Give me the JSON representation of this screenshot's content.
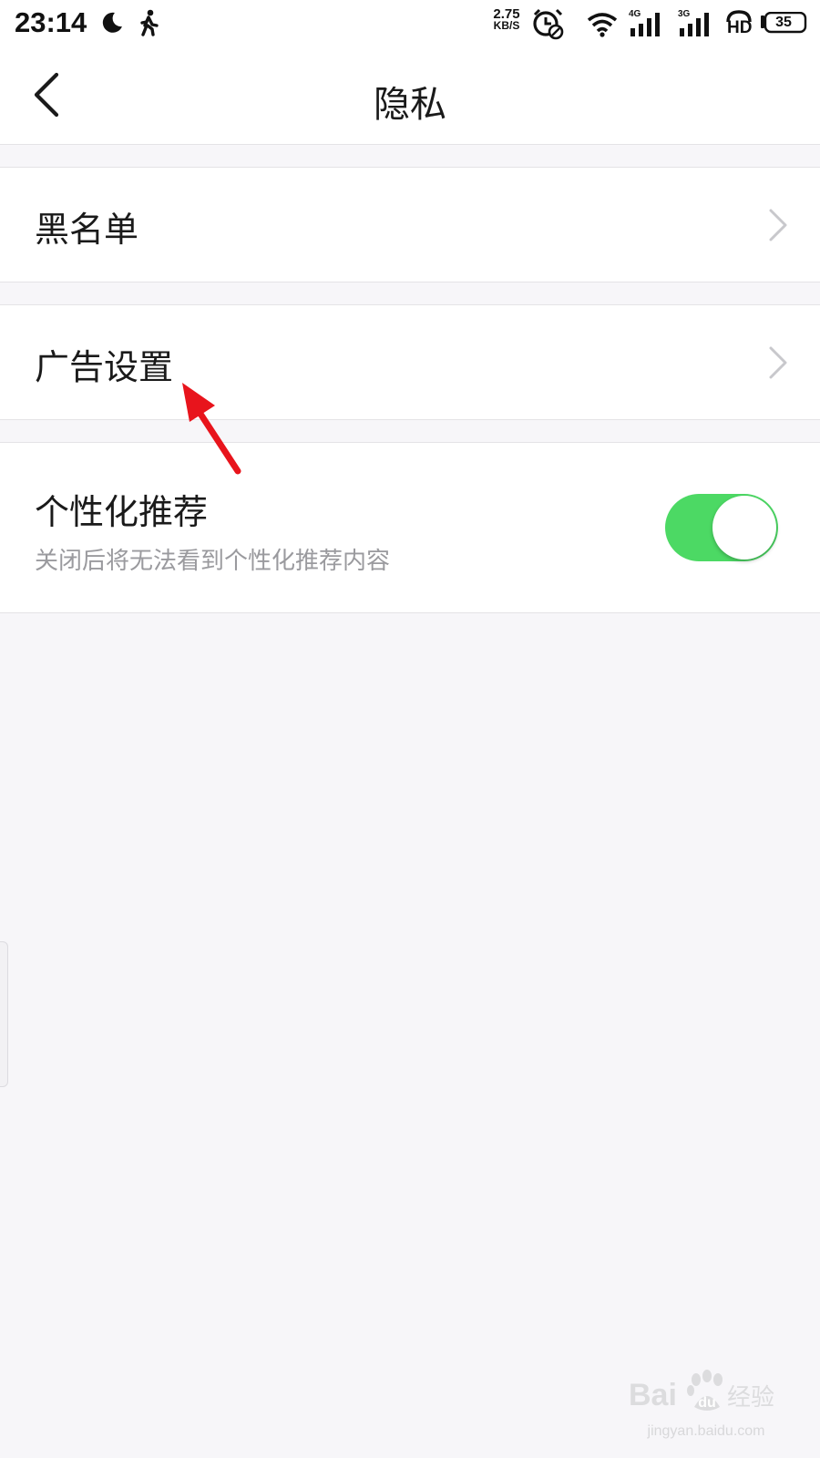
{
  "status_bar": {
    "time": "23:14",
    "net_speed_value": "2.75",
    "net_speed_unit": "KB/S",
    "network_1": "4G",
    "network_2": "3G",
    "hd_label": "HD",
    "battery_level": "35",
    "icons": [
      "moon-icon",
      "walking-icon",
      "alarm-icon",
      "wifi-icon",
      "signal-icon",
      "signal-icon",
      "hd-call-icon",
      "battery-icon"
    ]
  },
  "nav": {
    "title": "隐私",
    "back_icon": "chevron-left-icon"
  },
  "rows": {
    "blacklist": {
      "label": "黑名单"
    },
    "ad_settings": {
      "label": "广告设置"
    },
    "personalized": {
      "label": "个性化推荐",
      "description": "关闭后将无法看到个性化推荐内容",
      "toggle_on": true
    }
  },
  "colors": {
    "toggle_on": "#4cd964",
    "annotation_arrow": "#e8141c",
    "background": "#f7f6f9"
  },
  "watermark": {
    "logo": "Bai du 经验",
    "url": "jingyan.baidu.com"
  }
}
